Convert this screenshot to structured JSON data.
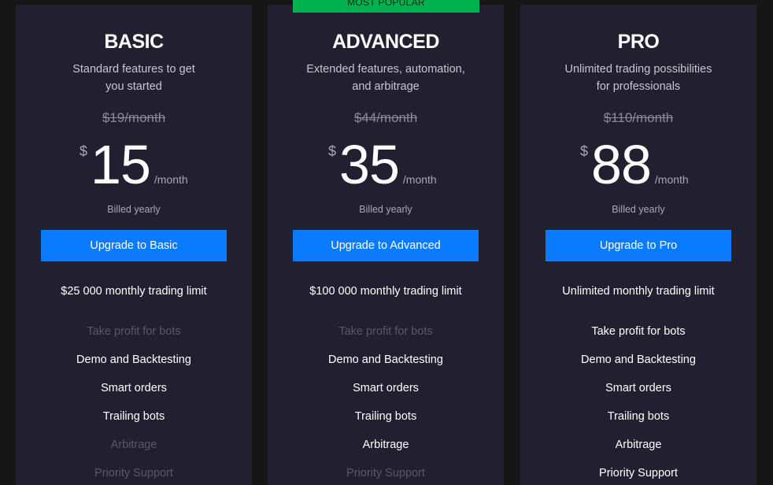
{
  "badge": "MOST POPULAR",
  "plans": [
    {
      "name": "BASIC",
      "desc_line1": "Standard features to get",
      "desc_line2": "you started",
      "old_price": "$19/month",
      "currency": "$",
      "amount": "15",
      "per": "/month",
      "billed": "Billed yearly",
      "cta": "Upgrade to Basic",
      "limit": "$25 000 monthly trading limit",
      "features": [
        {
          "label": "Take profit for bots",
          "enabled": false
        },
        {
          "label": "Demo and Backtesting",
          "enabled": true
        },
        {
          "label": "Smart orders",
          "enabled": true
        },
        {
          "label": "Trailing bots",
          "enabled": true
        },
        {
          "label": "Arbitrage",
          "enabled": false
        },
        {
          "label": "Priority Support",
          "enabled": false
        }
      ]
    },
    {
      "name": "ADVANCED",
      "desc_line1": "Extended features, automation,",
      "desc_line2": "and arbitrage",
      "old_price": "$44/month",
      "currency": "$",
      "amount": "35",
      "per": "/month",
      "billed": "Billed yearly",
      "cta": "Upgrade to Advanced",
      "limit": "$100 000 monthly trading limit",
      "features": [
        {
          "label": "Take profit for bots",
          "enabled": false
        },
        {
          "label": "Demo and Backtesting",
          "enabled": true
        },
        {
          "label": "Smart orders",
          "enabled": true
        },
        {
          "label": "Trailing bots",
          "enabled": true
        },
        {
          "label": "Arbitrage",
          "enabled": true
        },
        {
          "label": "Priority Support",
          "enabled": false
        }
      ]
    },
    {
      "name": "PRO",
      "desc_line1": "Unlimited trading possibilities",
      "desc_line2": "for professionals",
      "old_price": "$110/month",
      "currency": "$",
      "amount": "88",
      "per": "/month",
      "billed": "Billed yearly",
      "cta": "Upgrade to Pro",
      "limit": "Unlimited monthly trading limit",
      "features": [
        {
          "label": "Take profit for bots",
          "enabled": true
        },
        {
          "label": "Demo and Backtesting",
          "enabled": true
        },
        {
          "label": "Smart orders",
          "enabled": true
        },
        {
          "label": "Trailing bots",
          "enabled": true
        },
        {
          "label": "Arbitrage",
          "enabled": true
        },
        {
          "label": "Priority Support",
          "enabled": true
        }
      ]
    }
  ],
  "colors": {
    "background": "#161616",
    "card": "#221f31",
    "cta": "#0a7bff",
    "badge": "#00b14f",
    "feature_disabled": "#5a5767"
  }
}
